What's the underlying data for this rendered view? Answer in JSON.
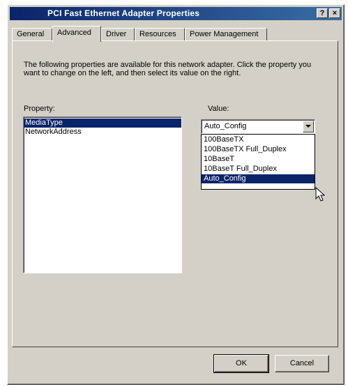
{
  "window": {
    "title": "PCI Fast Ethernet Adapter Properties",
    "help_label": "?",
    "close_label": "×"
  },
  "tabs": [
    {
      "label": "General"
    },
    {
      "label": "Advanced",
      "active": true
    },
    {
      "label": "Driver"
    },
    {
      "label": "Resources"
    },
    {
      "label": "Power Management"
    }
  ],
  "panel": {
    "description": "The following properties are available for this network adapter. Click the property you want to change on the left, and then select its value on the right.",
    "property_label": "Property:",
    "value_label": "Value:",
    "properties": [
      {
        "label": "MediaType",
        "selected": true
      },
      {
        "label": "NetworkAddress"
      }
    ],
    "value_combo": {
      "selected_value": "Auto_Config"
    },
    "value_options": [
      {
        "label": "100BaseTX"
      },
      {
        "label": "100BaseTX Full_Duplex"
      },
      {
        "label": "10BaseT"
      },
      {
        "label": "10BaseT Full_Duplex"
      },
      {
        "label": "Auto_Config",
        "highlighted": true
      }
    ]
  },
  "footer": {
    "ok_label": "OK",
    "cancel_label": "Cancel"
  },
  "colors": {
    "title_bar_start": "#0a246a",
    "title_bar_end": "#3a6ea5",
    "dialog_face": "#d4d0c8",
    "selection": "#0a246a"
  },
  "icons": {
    "cursor": "arrow-pointer-icon",
    "dropdown": "chevron-down-icon"
  }
}
